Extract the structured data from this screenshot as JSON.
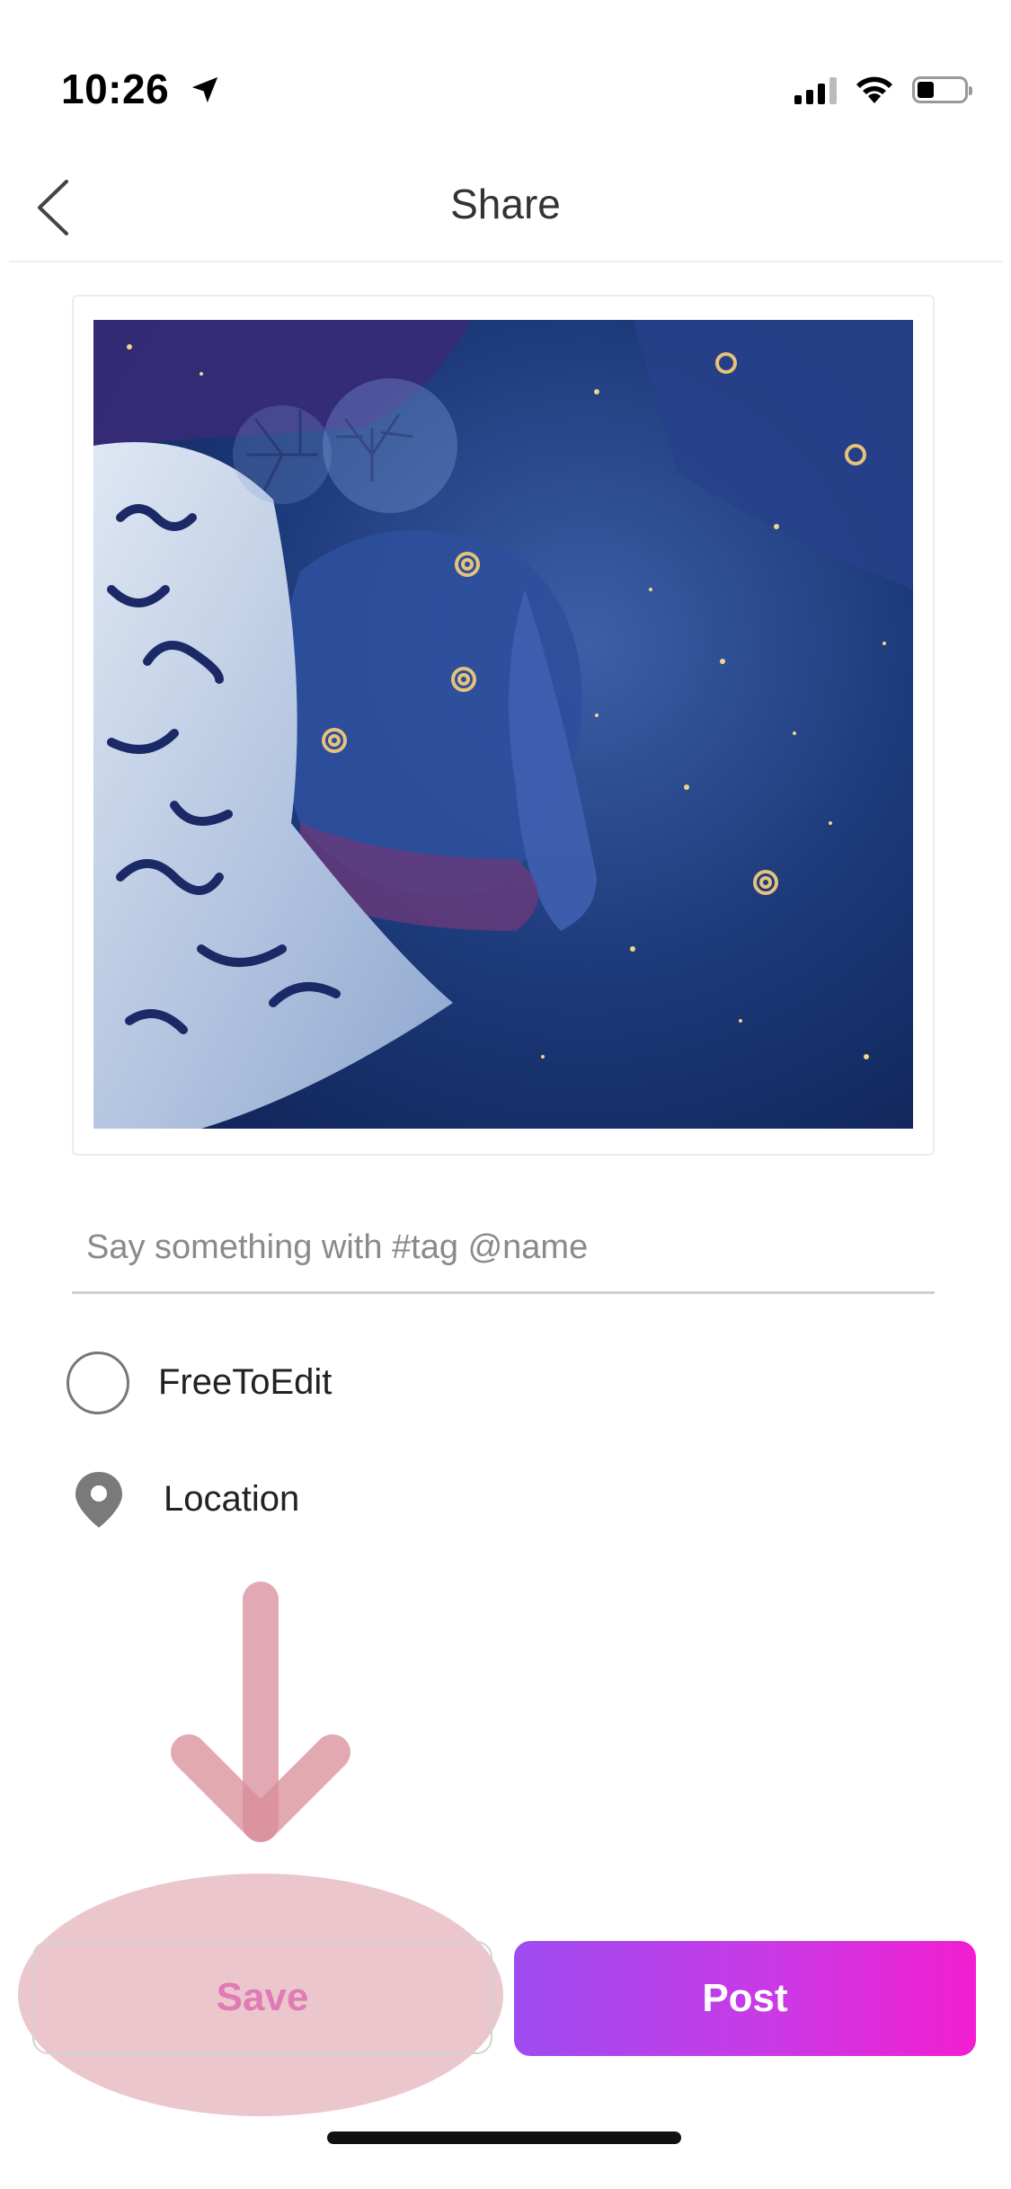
{
  "status_bar": {
    "time": "10:26",
    "location_icon": "location-arrow-icon",
    "signal_icon": "cellular-signal-icon",
    "wifi_icon": "wifi-icon",
    "battery_icon": "battery-icon"
  },
  "header": {
    "title": "Share",
    "back_icon": "chevron-left-icon"
  },
  "preview": {
    "image": "artwork-preview-image"
  },
  "caption": {
    "placeholder": "Say something with #tag @name",
    "value": ""
  },
  "options": {
    "free_to_edit": {
      "label": "FreeToEdit",
      "checked": false
    },
    "location": {
      "label": "Location",
      "icon": "map-pin-icon"
    }
  },
  "actions": {
    "save_label": "Save",
    "post_label": "Post"
  },
  "colors": {
    "save_text": "#e07bb6",
    "post_gradient_start": "#9d4cf0",
    "post_gradient_end": "#f21ed1",
    "annotation": "#d98c9a"
  }
}
